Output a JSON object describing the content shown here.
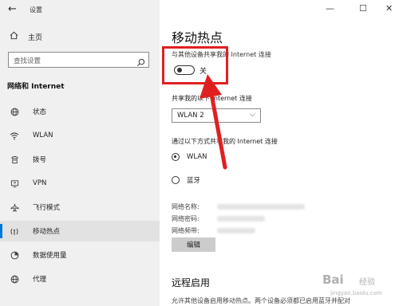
{
  "window": {
    "title": "设置",
    "controls": {
      "minimize": "—",
      "maximize": "☐",
      "close": "✕"
    }
  },
  "sidebar": {
    "home_label": "主页",
    "search_placeholder": "查找设置",
    "section_title": "网络和 Internet",
    "items": [
      {
        "label": "状态",
        "icon": "globe-icon"
      },
      {
        "label": "WLAN",
        "icon": "wifi-icon"
      },
      {
        "label": "拨号",
        "icon": "dialup-icon"
      },
      {
        "label": "VPN",
        "icon": "vpn-icon"
      },
      {
        "label": "飞行模式",
        "icon": "airplane-icon"
      },
      {
        "label": "移动热点",
        "icon": "hotspot-icon",
        "selected": true
      },
      {
        "label": "数据使用量",
        "icon": "data-usage-icon"
      },
      {
        "label": "代理",
        "icon": "proxy-icon"
      }
    ]
  },
  "main": {
    "title": "移动热点",
    "share_label": "与其他设备共享我的 Internet 连接",
    "toggle": {
      "state": "关",
      "on": false
    },
    "share_from_label": "共享我的以下 Internet 连接",
    "share_from_value": "WLAN 2",
    "share_via_label": "通过以下方式共享我的 Internet 连接",
    "radio_options": [
      {
        "label": "WLAN",
        "selected": true
      },
      {
        "label": "蓝牙",
        "selected": false
      }
    ],
    "network_info": {
      "name_label": "网络名称:",
      "password_label": "网络密码:",
      "band_label": "网络频带:"
    },
    "edit_button": "编辑",
    "remote_title": "远程启用",
    "remote_desc": "允许其他设备启用移动热点。两个设备必须都已启用蓝牙并配对"
  },
  "annotation": {
    "highlight_color": "#e02020"
  },
  "watermark": {
    "brand": "Bai",
    "suffix": "经验",
    "url": "jingyan.baidu.com"
  }
}
